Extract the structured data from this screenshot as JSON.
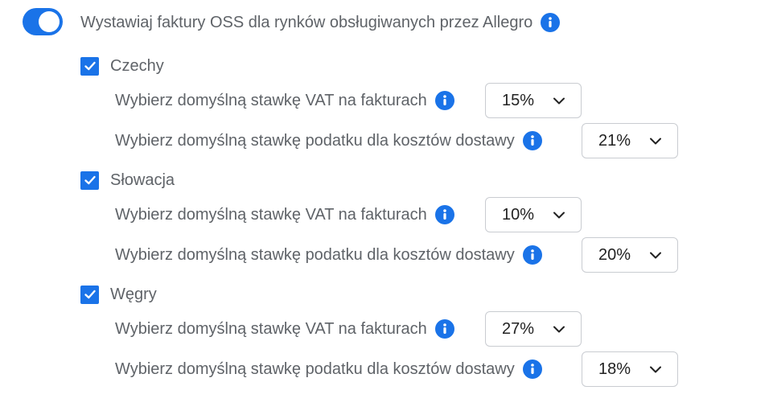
{
  "oss": {
    "enabled": true,
    "label": "Wystawiaj faktury OSS dla rynków obsługiwanych przez Allegro",
    "info_icon": "info-icon"
  },
  "countries": [
    {
      "name": "Czechy",
      "checked": true,
      "vat_label": "Wybierz domyślną stawkę VAT na fakturach",
      "vat_value": "15%",
      "shipping_label": "Wybierz domyślną stawkę podatku dla kosztów dostawy",
      "shipping_value": "21%"
    },
    {
      "name": "Słowacja",
      "checked": true,
      "vat_label": "Wybierz domyślną stawkę VAT na fakturach",
      "vat_value": "10%",
      "shipping_label": "Wybierz domyślną stawkę podatku dla kosztów dostawy",
      "shipping_value": "20%"
    },
    {
      "name": "Węgry",
      "checked": true,
      "vat_label": "Wybierz domyślną stawkę VAT na fakturach",
      "vat_value": "27%",
      "shipping_label": "Wybierz domyślną stawkę podatku dla kosztów dostawy",
      "shipping_value": "18%"
    }
  ],
  "colors": {
    "accent": "#1a73e8",
    "text": "#5f6368",
    "select_text": "#222222",
    "border": "#c9ccd1"
  }
}
